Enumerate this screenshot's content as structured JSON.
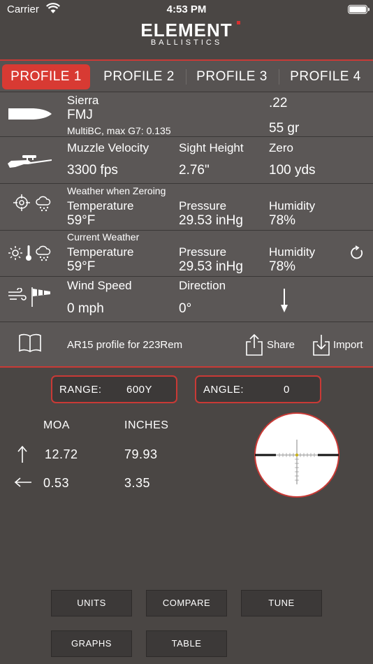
{
  "status": {
    "carrier": "Carrier",
    "time": "4:53 PM"
  },
  "brand": {
    "name": "ELEMENT",
    "sub": "BALLISTICS"
  },
  "tabs": [
    "PROFILE 1",
    "PROFILE 2",
    "PROFILE 3",
    "PROFILE 4"
  ],
  "active_tab": 0,
  "bullet": {
    "brand": "Sierra",
    "type": "FMJ",
    "bc": "MultiBC, max G7: 0.135",
    "caliber": ".22",
    "weight": "55 gr"
  },
  "rifle": {
    "muzzle_velocity_label": "Muzzle Velocity",
    "muzzle_velocity": "3300 fps",
    "sight_height_label": "Sight Height",
    "sight_height": "2.76\"",
    "zero_label": "Zero",
    "zero": "100 yds"
  },
  "zero_weather": {
    "title": "Weather when Zeroing",
    "temperature_label": "Temperature",
    "temperature": "59°F",
    "pressure_label": "Pressure",
    "pressure": "29.53 inHg",
    "humidity_label": "Humidity",
    "humidity": "78%"
  },
  "current_weather": {
    "title": "Current Weather",
    "temperature_label": "Temperature",
    "temperature": "59°F",
    "pressure_label": "Pressure",
    "pressure": "29.53 inHg",
    "humidity_label": "Humidity",
    "humidity": "78%"
  },
  "wind": {
    "speed_label": "Wind Speed",
    "speed": "0 mph",
    "direction_label": "Direction",
    "direction": "0°"
  },
  "notes": {
    "text": "AR15 profile for 223Rem",
    "share_label": "Share",
    "import_label": "Import"
  },
  "range": {
    "label": "RANGE:",
    "value": "600Y"
  },
  "angle": {
    "label": "ANGLE:",
    "value": "0"
  },
  "results": {
    "col1": "MOA",
    "col2": "INCHES",
    "elevation_moa": "12.72",
    "elevation_inches": "79.93",
    "windage_moa": "0.53",
    "windage_inches": "3.35"
  },
  "buttons": {
    "units": "UNITS",
    "compare": "COMPARE",
    "tune": "TUNE",
    "graphs": "GRAPHS",
    "table": "TABLE"
  },
  "colors": {
    "accent": "#d83a33",
    "background": "#4a4644",
    "row": "#5b5756",
    "button": "#3c3938"
  }
}
